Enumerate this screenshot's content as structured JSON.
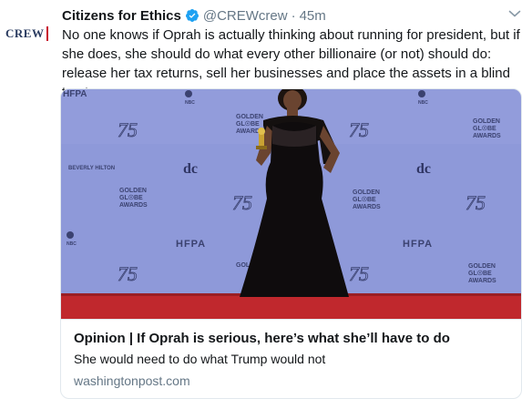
{
  "avatar": {
    "text": "CREW",
    "accent": "#c8102e",
    "brand": "#2a3b60"
  },
  "tweet": {
    "name": "Citizens for Ethics",
    "verified_icon": "verified-badge-icon",
    "handle": "@CREWcrew",
    "separator": "·",
    "time": "45m",
    "menu_icon": "chevron-down-icon",
    "text": "No one knows if Oprah is actually thinking about running for president, but if she does, she should do what every other billionaire (or not) should do: release her tax returns, sell her businesses and place the assets in a blind trust"
  },
  "card": {
    "image_alt": "Photo of Oprah at the Golden Globe Awards",
    "backdrop_texts": {
      "golden": "GOLDEN",
      "globe": "GL☉BE",
      "awards": "AWARDS",
      "hfpa": "HFPA",
      "nbc": "NBC",
      "seventyfive": "75",
      "beverly": "BEVERLY HILTON"
    },
    "title": "Opinion | If Oprah is serious, here’s what she’ll have to do",
    "description": "She would need to do what Trump would not",
    "domain": "washingtonpost.com"
  },
  "colors": {
    "link_gray": "#657786",
    "verified_blue": "#1da1f2",
    "backdrop": "#8b98d9",
    "carpet": "#c0282d"
  }
}
